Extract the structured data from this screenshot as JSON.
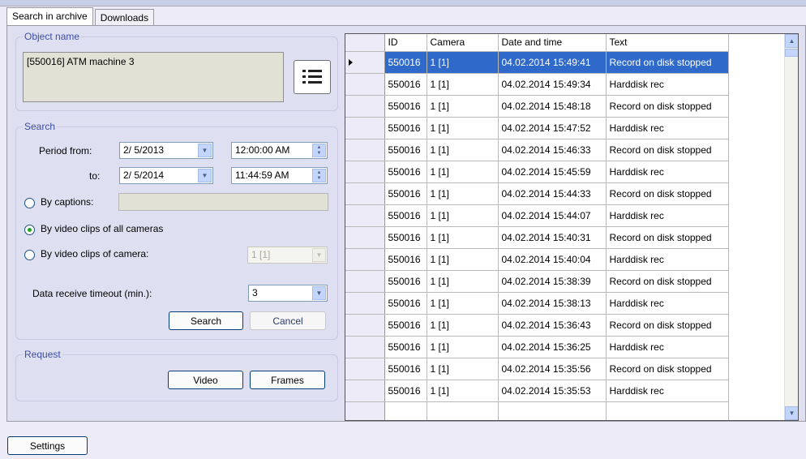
{
  "tabs": [
    {
      "label": "Search in archive",
      "active": true
    },
    {
      "label": "Downloads",
      "active": false
    }
  ],
  "object": {
    "group_title": "Object name",
    "value": "[550016] ATM machine 3",
    "list_icon": "list-icon"
  },
  "search": {
    "group_title": "Search",
    "period_from_label": "Period from:",
    "from_date": "2/ 5/2013",
    "from_time": "12:00:00 AM",
    "to_label": "to:",
    "to_date": "2/ 5/2014",
    "to_time": "11:44:59 AM",
    "by_captions_label": "By captions:",
    "by_all_cameras_label": "By video clips of all cameras",
    "by_camera_label": "By video clips of camera:",
    "camera_value": "1 [1]",
    "timeout_label": "Data receive timeout (min.):",
    "timeout_value": "3",
    "search_button": "Search",
    "cancel_button": "Cancel",
    "selected_mode": "all_cameras"
  },
  "request": {
    "group_title": "Request",
    "video_button": "Video",
    "frames_button": "Frames"
  },
  "grid": {
    "columns": [
      "ID",
      "Camera",
      "Date and time",
      "Text"
    ],
    "rows": [
      [
        "550016",
        "1 [1]",
        "04.02.2014 15:49:41",
        "Record on disk stopped"
      ],
      [
        "550016",
        "1 [1]",
        "04.02.2014 15:49:34",
        "Harddisk rec"
      ],
      [
        "550016",
        "1 [1]",
        "04.02.2014 15:48:18",
        "Record on disk stopped"
      ],
      [
        "550016",
        "1 [1]",
        "04.02.2014 15:47:52",
        "Harddisk rec"
      ],
      [
        "550016",
        "1 [1]",
        "04.02.2014 15:46:33",
        "Record on disk stopped"
      ],
      [
        "550016",
        "1 [1]",
        "04.02.2014 15:45:59",
        "Harddisk rec"
      ],
      [
        "550016",
        "1 [1]",
        "04.02.2014 15:44:33",
        "Record on disk stopped"
      ],
      [
        "550016",
        "1 [1]",
        "04.02.2014 15:44:07",
        "Harddisk rec"
      ],
      [
        "550016",
        "1 [1]",
        "04.02.2014 15:40:31",
        "Record on disk stopped"
      ],
      [
        "550016",
        "1 [1]",
        "04.02.2014 15:40:04",
        "Harddisk rec"
      ],
      [
        "550016",
        "1 [1]",
        "04.02.2014 15:38:39",
        "Record on disk stopped"
      ],
      [
        "550016",
        "1 [1]",
        "04.02.2014 15:38:13",
        "Harddisk rec"
      ],
      [
        "550016",
        "1 [1]",
        "04.02.2014 15:36:43",
        "Record on disk stopped"
      ],
      [
        "550016",
        "1 [1]",
        "04.02.2014 15:36:25",
        "Harddisk rec"
      ],
      [
        "550016",
        "1 [1]",
        "04.02.2014 15:35:56",
        "Record on disk stopped"
      ],
      [
        "550016",
        "1 [1]",
        "04.02.2014 15:35:53",
        "Harddisk rec"
      ]
    ],
    "selected_row": 0
  },
  "settings_button": "Settings",
  "colors": {
    "selection": "#2f69c9",
    "group_title": "#3c4ea0",
    "panel": "#dfdff2"
  }
}
